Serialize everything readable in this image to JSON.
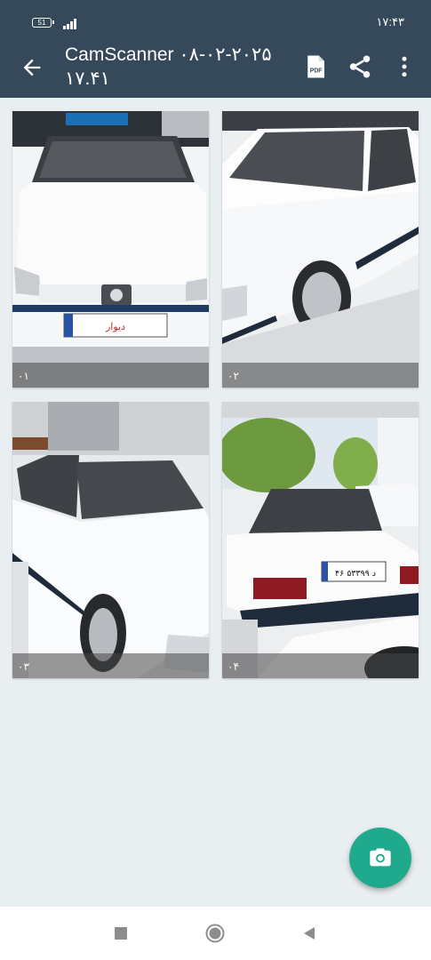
{
  "status_bar": {
    "battery": "51",
    "time": "۱۷:۴۳"
  },
  "app_bar": {
    "title": "CamScanner ۰۸-۰۲-۲۰۲۵ ۱۷.۴۱"
  },
  "pages": [
    {
      "number": "۰۱",
      "plate_text": "دیوار"
    },
    {
      "number": "۰۲"
    },
    {
      "number": "۰۳"
    },
    {
      "number": "۰۴",
      "plate_text": "۴۶ د ۵۳۳۹۹"
    }
  ],
  "colors": {
    "app_bar": "#35495b",
    "background": "#e9eef1",
    "fab": "#1faa8e"
  },
  "icons": {
    "back": "arrow-left-icon",
    "pdf": "pdf-icon",
    "share": "share-icon",
    "more": "more-vertical-icon",
    "fab": "camera-icon"
  }
}
